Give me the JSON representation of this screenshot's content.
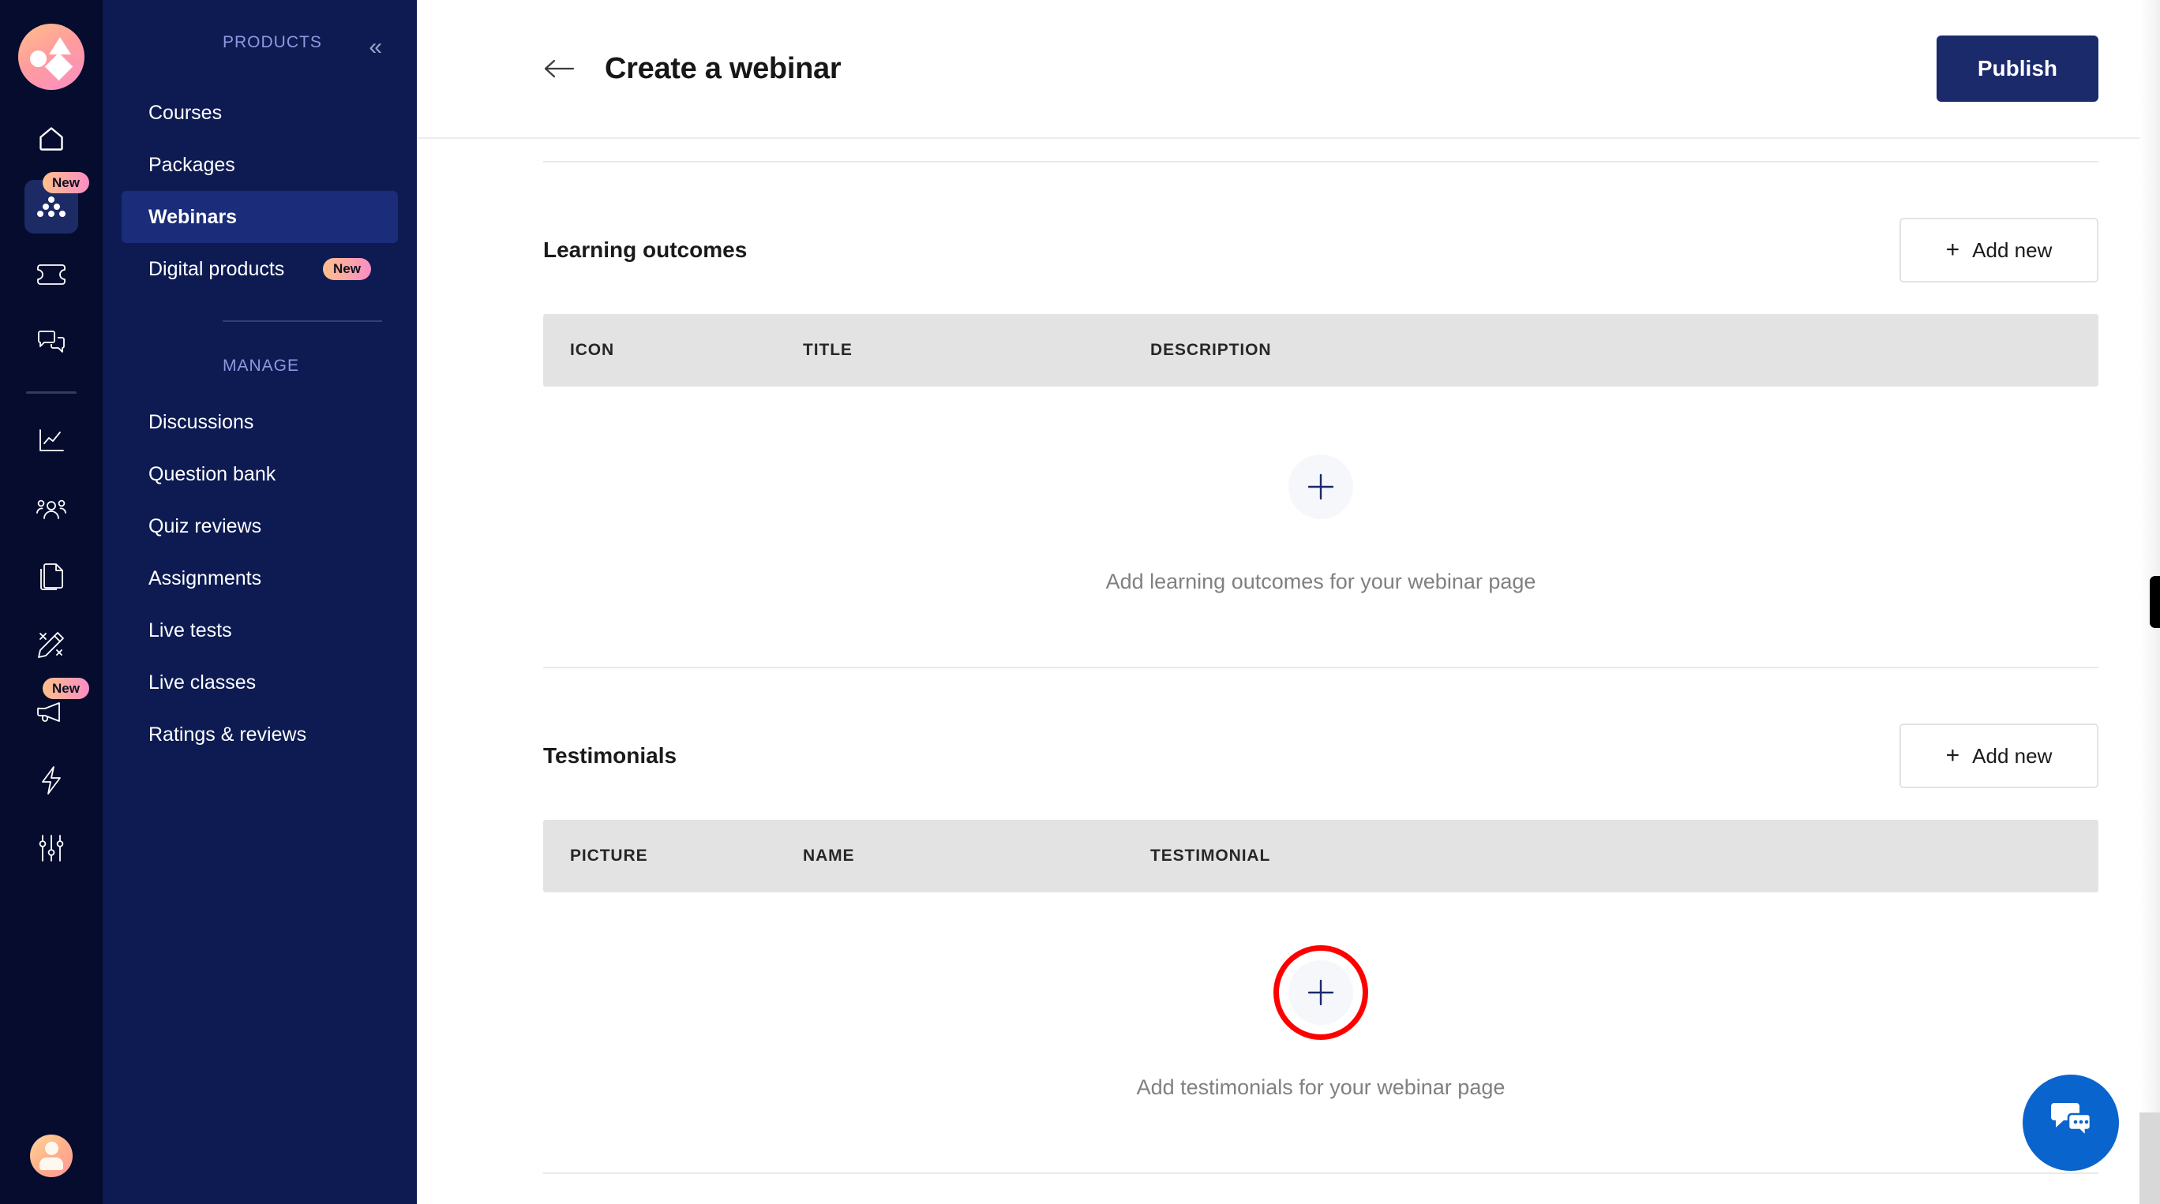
{
  "brand": {
    "logo_icon": "graphy-logo-icon",
    "accent_navy": "#0d1b52",
    "accent_rail": "#050c2e",
    "publish_blue": "#1b2a6b",
    "highlight_red": "#ff0000",
    "chat_blue": "#0a64cd"
  },
  "rail": {
    "items": [
      {
        "icon": "home-icon",
        "name": "rail-item-home",
        "badge": "",
        "active": false
      },
      {
        "icon": "products-icon",
        "name": "rail-item-products",
        "badge": "New",
        "active": true
      },
      {
        "icon": "ticket-icon",
        "name": "rail-item-coupons",
        "badge": "",
        "active": false
      },
      {
        "icon": "chat-bubbles-icon",
        "name": "rail-item-conversations",
        "badge": "",
        "active": false
      },
      {
        "icon": "analytics-chart-icon",
        "name": "rail-item-analytics",
        "badge": "",
        "active": false
      },
      {
        "icon": "users-icon",
        "name": "rail-item-learners",
        "badge": "",
        "active": false
      },
      {
        "icon": "pages-copy-icon",
        "name": "rail-item-pages",
        "badge": "",
        "active": false
      },
      {
        "icon": "pencil-design-icon",
        "name": "rail-item-design",
        "badge": "",
        "active": false
      },
      {
        "icon": "megaphone-icon",
        "name": "rail-item-marketing",
        "badge": "New",
        "active": false
      },
      {
        "icon": "lightning-bolt-icon",
        "name": "rail-item-automations",
        "badge": "",
        "active": false
      },
      {
        "icon": "sliders-settings-icon",
        "name": "rail-item-settings",
        "badge": "",
        "active": false
      }
    ],
    "avatar": "user-avatar"
  },
  "sidebar": {
    "section_products_label": "PRODUCTS",
    "collapse_label": "«",
    "products": [
      {
        "label": "Courses",
        "badge": "",
        "active": false
      },
      {
        "label": "Packages",
        "badge": "",
        "active": false
      },
      {
        "label": "Webinars",
        "badge": "",
        "active": true
      },
      {
        "label": "Digital products",
        "badge": "New",
        "active": false
      }
    ],
    "section_manage_label": "MANAGE",
    "manage": [
      {
        "label": "Discussions",
        "badge": "",
        "active": false
      },
      {
        "label": "Question bank",
        "badge": "",
        "active": false
      },
      {
        "label": "Quiz reviews",
        "badge": "",
        "active": false
      },
      {
        "label": "Assignments",
        "badge": "",
        "active": false
      },
      {
        "label": "Live tests",
        "badge": "",
        "active": false
      },
      {
        "label": "Live classes",
        "badge": "",
        "active": false
      },
      {
        "label": "Ratings & reviews",
        "badge": "",
        "active": false
      }
    ]
  },
  "topbar": {
    "back_icon": "arrow-left-icon",
    "title": "Create a webinar",
    "publish_label": "Publish"
  },
  "sections": [
    {
      "title": "Learning outcomes",
      "add_new_label": "Add new",
      "add_new_plus": "+",
      "columns": [
        "ICON",
        "TITLE",
        "DESCRIPTION"
      ],
      "empty_text": "Add learning outcomes for your webinar page",
      "highlighted": false
    },
    {
      "title": "Testimonials",
      "add_new_label": "Add new",
      "add_new_plus": "+",
      "columns": [
        "PICTURE",
        "NAME",
        "TESTIMONIAL"
      ],
      "empty_text": "Add testimonials for your webinar page",
      "highlighted": true
    }
  ],
  "chat": {
    "icon": "chat-support-icon"
  }
}
